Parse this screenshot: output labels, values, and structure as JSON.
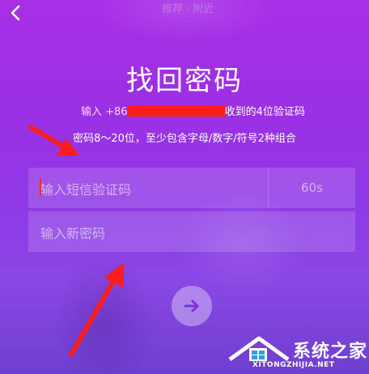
{
  "header": {
    "back_icon": "chevron-left-icon",
    "faded_text": "推荐 · 附近"
  },
  "main": {
    "title": "找回密码",
    "sms_prefix": "输入 +86",
    "sms_suffix": "收到的4位验证码",
    "password_rule": "密码8～20位，至少包含字母/数字/符号2种组合",
    "code_placeholder": "输入短信验证码",
    "countdown": "60s",
    "password_placeholder": "输入新密码",
    "next_icon": "arrow-right-icon"
  },
  "watermark": {
    "brand": "系统之家",
    "url": "XITONGZHIJIA.NET"
  },
  "colors": {
    "annotation_red": "#ff1d1d",
    "bg_top": "#a82fe6",
    "bg_bottom": "#6e3fd0"
  }
}
